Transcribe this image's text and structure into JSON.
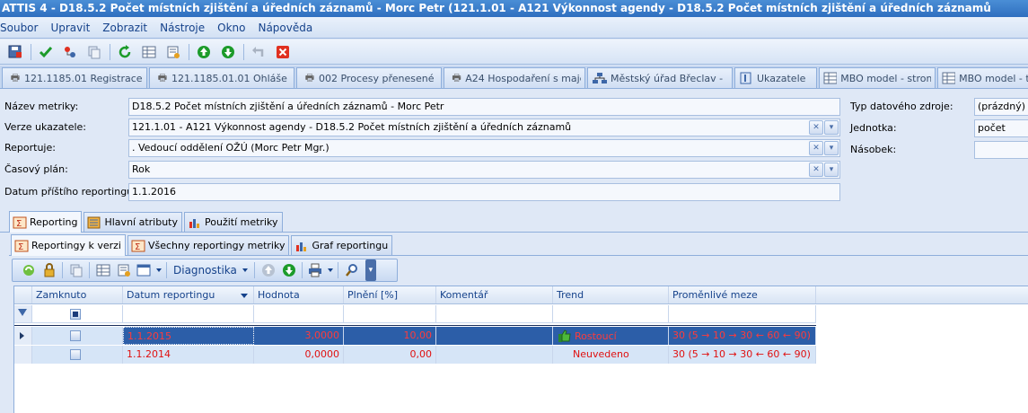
{
  "window": {
    "title": "ATTIS 4 - D18.5.2 Počet místních zjištění a úředních záznamů - Morc Petr (121.1.01 - A121 Výkonnost agendy - D18.5.2 Počet místních zjištění a úředních záznamů"
  },
  "menu": [
    "Soubor",
    "Upravit",
    "Zobrazit",
    "Nástroje",
    "Okno",
    "Nápověda"
  ],
  "doc_tabs": [
    {
      "label": "121.1185.01 Registrace",
      "icon": "print-icon"
    },
    {
      "label": "121.1185.01.01 Ohláše",
      "icon": "print-icon"
    },
    {
      "label": "002 Procesy přenesené",
      "icon": "print-icon"
    },
    {
      "label": "A24 Hospodaření s maje",
      "icon": "print-icon"
    },
    {
      "label": "Městský úřad Břeclav -",
      "icon": "org-chart-icon"
    },
    {
      "label": "Ukazatele",
      "icon": "indicator-icon"
    },
    {
      "label": "MBO model - strom",
      "icon": "grid-icon"
    },
    {
      "label": "MBO model - ta",
      "icon": "grid-icon"
    }
  ],
  "form": {
    "metric_name": {
      "label": "Název metriky:",
      "value": "D18.5.2 Počet místních zjištění a úředních záznamů - Morc Petr"
    },
    "indicator_version": {
      "label": "Verze ukazatele:",
      "value": "121.1.01 - A121 Výkonnost agendy - D18.5.2 Počet místních zjištění a úředních záznamů"
    },
    "reporter": {
      "label": "Reportuje:",
      "value": ". Vedoucí oddělení OŽÚ (Morc Petr Mgr.)"
    },
    "time_plan": {
      "label": "Časový plán:",
      "value": "Rok"
    },
    "next_report_date": {
      "label": "Datum příštího reportingu:",
      "value": "1.1.2016"
    },
    "data_source_type": {
      "label": "Typ datového zdroje:",
      "value": "(prázdný)"
    },
    "unit": {
      "label": "Jednotka:",
      "value": "počet"
    },
    "multiplier": {
      "label": "Násobek:",
      "value": ""
    }
  },
  "section_tabs": [
    "Reporting",
    "Hlavní atributy",
    "Použití metriky"
  ],
  "sub_tabs": [
    "Reportingy k verzi",
    "Všechny reportingy metriky",
    "Graf reportingu"
  ],
  "grid_toolbar": {
    "diagnostics_label": "Diagnostika"
  },
  "grid": {
    "columns": [
      "Zamknuto",
      "Datum reportingu",
      "Hodnota",
      "Plnění [%]",
      "Komentář",
      "Trend",
      "Proměnlivé meze"
    ],
    "rows": [
      {
        "locked": false,
        "date": "1.1.2015",
        "value": "3,0000",
        "fulfillment": "10,00",
        "comment": "",
        "trend": "Rostoucí",
        "limits": "30 (5 → 10 → 30 ← 60 ← 90)",
        "selected": true
      },
      {
        "locked": false,
        "date": "1.1.2014",
        "value": "0,0000",
        "fulfillment": "0,00",
        "comment": "",
        "trend": "Neuvedeno",
        "limits": "30 (5 → 10 → 30 ← 60 ← 90)",
        "selected": false
      }
    ]
  },
  "colors": {
    "accent": "#2c5ea8",
    "error_text": "#e01010",
    "header_text": "#15428b"
  }
}
